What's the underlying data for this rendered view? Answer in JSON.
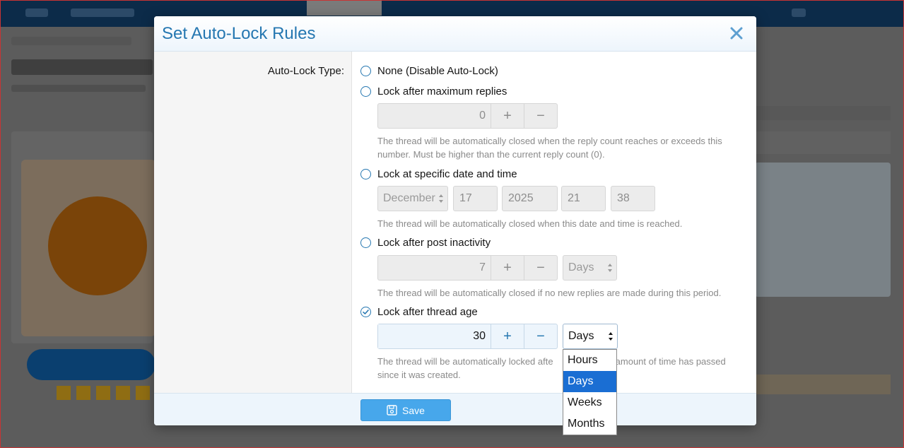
{
  "modal": {
    "title": "Set Auto-Lock Rules",
    "field_label": "Auto-Lock Type:",
    "options": [
      {
        "label": "None (Disable Auto-Lock)",
        "checked": false
      },
      {
        "label": "Lock after maximum replies",
        "checked": false
      },
      {
        "label": "Lock at specific date and time",
        "checked": false
      },
      {
        "label": "Lock after post inactivity",
        "checked": false
      },
      {
        "label": "Lock after thread age",
        "checked": true
      }
    ],
    "max_replies": {
      "value": "0",
      "plus": "+",
      "minus": "−",
      "hint": "The thread will be automatically closed when the reply count reaches or exceeds this number. Must be higher than the current reply count (0)."
    },
    "specific_date": {
      "month": "December",
      "day": "17",
      "year": "2025",
      "hour": "21",
      "minute": "38",
      "hint": "The thread will be automatically closed when this date and time is reached."
    },
    "inactivity": {
      "value": "7",
      "plus": "+",
      "minus": "−",
      "unit": "Days",
      "hint": "The thread will be automatically closed if no new replies are made during this period."
    },
    "thread_age": {
      "value": "30",
      "plus": "+",
      "minus": "−",
      "unit": "Days",
      "hint_before": "The thread will be automatically locked afte",
      "hint_after": "ed amount of time has passed",
      "hint_line2": "since it was created."
    },
    "unit_dropdown": {
      "options": [
        "Hours",
        "Days",
        "Weeks",
        "Months"
      ],
      "selected": "Days"
    },
    "save_label": "Save"
  },
  "colors": {
    "accent": "#2577b1",
    "save_button": "#47a7eb",
    "dropdown_selected": "#1a6ed3",
    "hint_text": "#8a8a8a"
  },
  "icons": {
    "close": "close-icon",
    "save": "save-icon",
    "radio_checked": "check-circle-icon"
  }
}
